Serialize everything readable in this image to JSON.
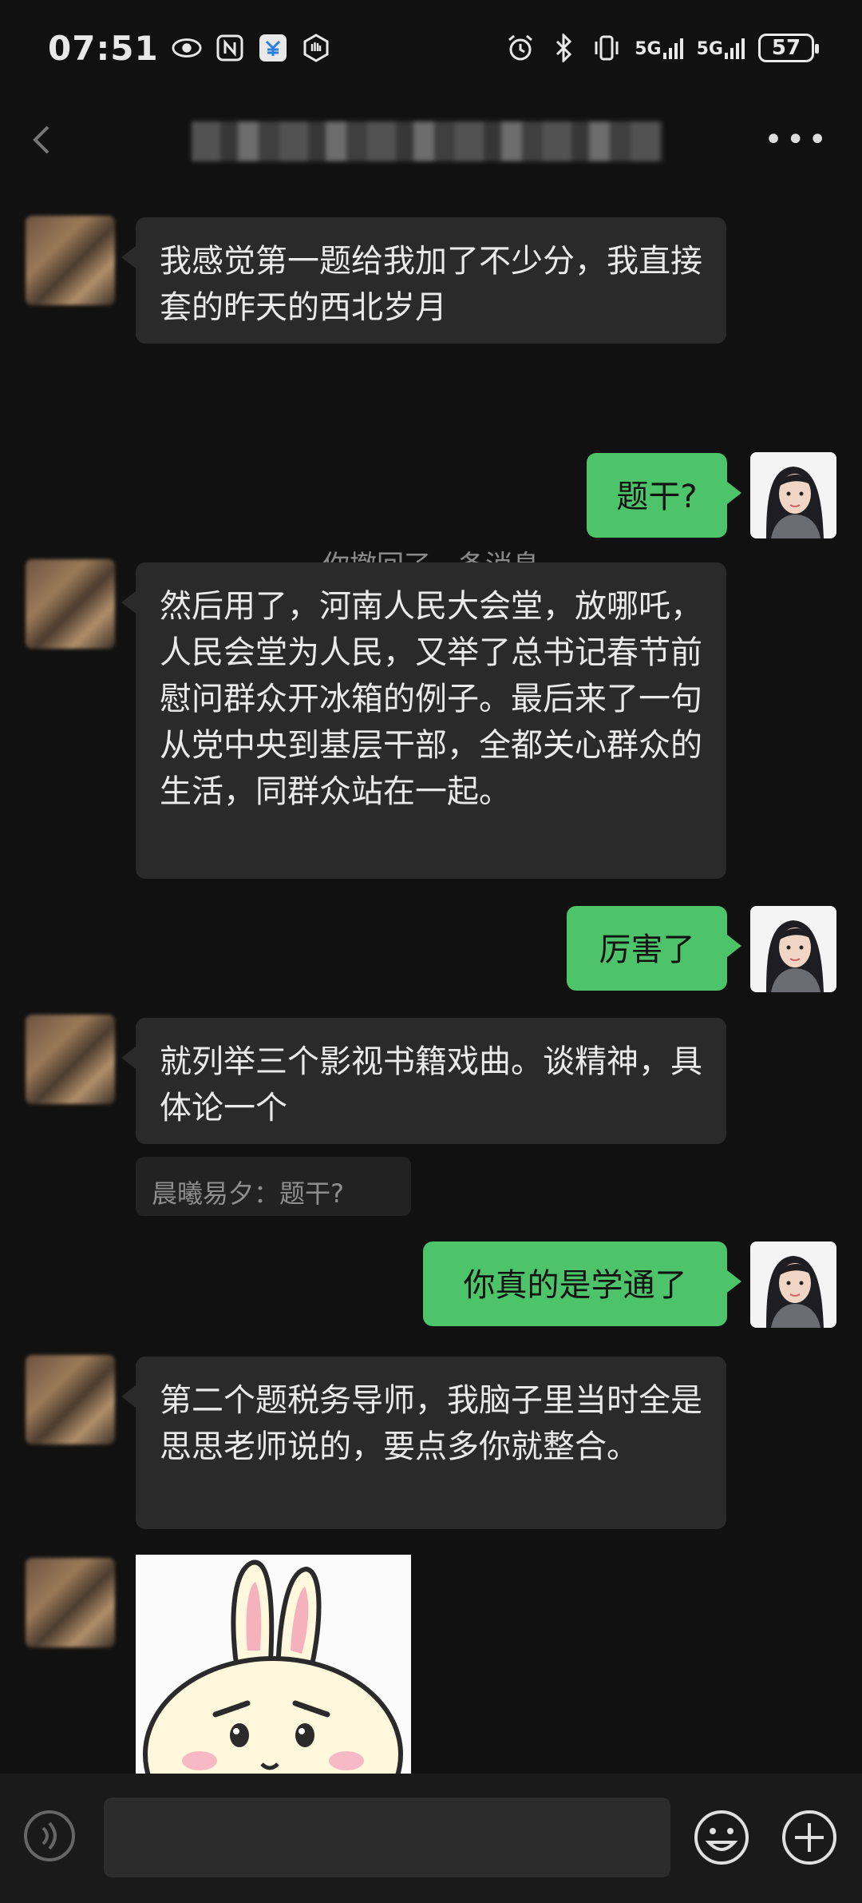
{
  "status_bar": {
    "time": "07:51",
    "signal1": "5G",
    "signal2": "5G",
    "battery": "57",
    "left_icons": [
      "eye-icon",
      "nfc-icon",
      "app-icon",
      "hand-icon"
    ],
    "right_icons": [
      "alarm-icon",
      "bluetooth-icon",
      "vibrate-icon"
    ]
  },
  "header": {
    "title": "",
    "more_label": "•••"
  },
  "messages": [
    {
      "side": "left",
      "text": "我感觉第一题给我加了不少分，我直接套的昨天的西北岁月"
    },
    {
      "system": "你撤回了一条消息"
    },
    {
      "side": "right",
      "text": "题干?"
    },
    {
      "side": "left",
      "text": "然后用了，河南人民大会堂，放哪吒，人民会堂为人民，又举了总书记春节前慰问群众开冰箱的例子。最后来了一句从党中央到基层干部，全都关心群众的生活，同群众站在一起。"
    },
    {
      "side": "right",
      "text": "厉害了"
    },
    {
      "side": "left",
      "text": "就列举三个影视书籍戏曲。谈精神，具体论一个"
    },
    {
      "quote": "晨曦易夕：题干?"
    },
    {
      "side": "right",
      "text": "你真的是学通了"
    },
    {
      "side": "left",
      "text": "第二个题税务导师，我脑子里当时全是思思老师说的，要点多你就整合。"
    }
  ],
  "input_bar": {
    "voice_icon": "voice-icon",
    "emoji_icon": "emoji-icon",
    "plus_icon": "plus-icon"
  }
}
